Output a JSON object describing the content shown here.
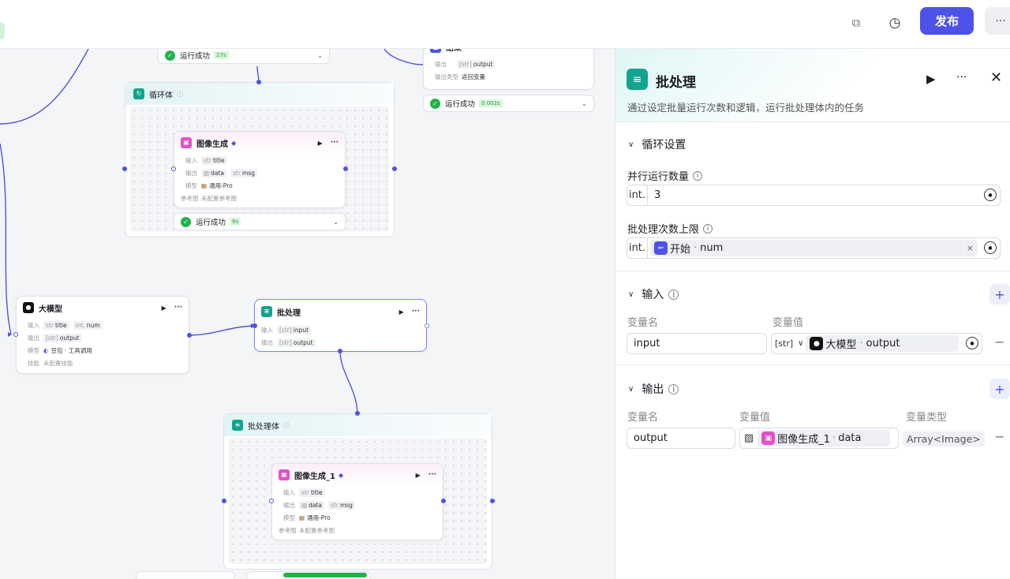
{
  "topbar": {
    "publish_label": "发布",
    "more": "···"
  },
  "canvas": {
    "status_top_left": {
      "label": "运行成功",
      "time": "27s"
    },
    "end_node": {
      "title": "结束",
      "rows": [
        {
          "label": "输出",
          "chip": "output",
          "chip_type": "[str]"
        },
        {
          "label": "输出类型",
          "value": "返回变量"
        }
      ]
    },
    "status_end": {
      "label": "运行成功",
      "time": "0.002s"
    },
    "loop_group": {
      "title": "循环体"
    },
    "image_node": {
      "title": "图像生成",
      "input_label": "输入",
      "input_type": "str",
      "input_var": "title",
      "output_label": "输出",
      "out1": "data",
      "out2_type": "str",
      "out2": "msg",
      "model_label": "模型",
      "model_value": "通用-Pro",
      "ref_label": "参考图",
      "ref_value": "未配置参考图"
    },
    "status_image": {
      "label": "运行成功",
      "time": "9s"
    },
    "llm_node": {
      "title": "大模型",
      "input_label": "输入",
      "in1_type": "str",
      "in1": "title",
      "in2_type": "int.",
      "in2": "num",
      "output_label": "输出",
      "out_type": "[str]",
      "out": "output",
      "model_label": "模型",
      "model_value": "豆包 · 工具调用",
      "skill_label": "技能",
      "skill_value": "未配置技能"
    },
    "batch_node": {
      "title": "批处理",
      "input_label": "输入",
      "in_type": "[str]",
      "in": "input",
      "output_label": "输出",
      "out_type": "[str]",
      "out": "output"
    },
    "batch_group": {
      "title": "批处理体"
    },
    "image_node_1": {
      "title": "图像生成_1",
      "input_label": "输入",
      "input_type": "str",
      "input_var": "title",
      "output_label": "输出",
      "out1": "data",
      "out2_type": "str",
      "out2": "msg",
      "model_label": "模型",
      "model_value": "通用-Pro",
      "ref_label": "参考图",
      "ref_value": "未配置参考图"
    }
  },
  "panel": {
    "title": "批处理",
    "description": "通过设定批量运行次数和逻辑，运行批处理体内的任务",
    "loop_settings": {
      "header": "循环设置",
      "parallel_label": "并行运行数量",
      "parallel_type": "int.",
      "parallel_value": "3",
      "max_label": "批处理次数上限",
      "max_type": "int.",
      "max_ref_node": "开始",
      "max_ref_var": "num"
    },
    "inputs": {
      "header": "输入",
      "col_name": "变量名",
      "col_value": "变量值",
      "row": {
        "name": "input",
        "type": "[str]",
        "ref_node": "大模型",
        "ref_var": "output"
      }
    },
    "outputs": {
      "header": "输出",
      "col_name": "变量名",
      "col_value": "变量值",
      "col_type": "变量类型",
      "row": {
        "name": "output",
        "ref_node": "图像生成_1",
        "ref_var": "data",
        "type": "Array<Image>"
      }
    }
  }
}
